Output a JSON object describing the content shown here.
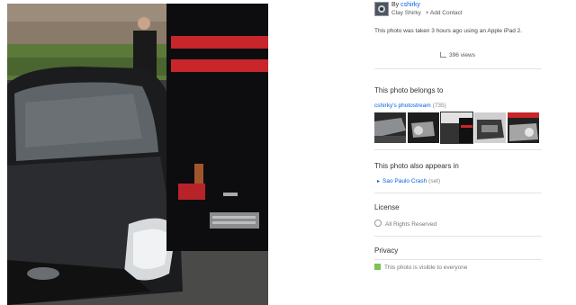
{
  "owner": {
    "by_prefix": "By",
    "username": "cshirky",
    "real_name": "Clay Shirky",
    "add_contact": "+ Add Contact"
  },
  "description": "This photo was taken 3 hours ago using an Apple iPad 2.",
  "views": "396 views",
  "belongs": {
    "heading": "This photo belongs to",
    "photostream_label": "cshirky's photostream",
    "photostream_count": "(735)"
  },
  "appears": {
    "heading": "This photo also appears in",
    "set_name": "Sao Paulo Crash",
    "set_kind": "(set)"
  },
  "license": {
    "heading": "License",
    "value": "All Rights Reserved"
  },
  "privacy": {
    "heading": "Privacy",
    "value": "This photo is visible to everyone"
  },
  "colors": {
    "link": "#0063dc",
    "privacy_green": "#7cc356"
  }
}
